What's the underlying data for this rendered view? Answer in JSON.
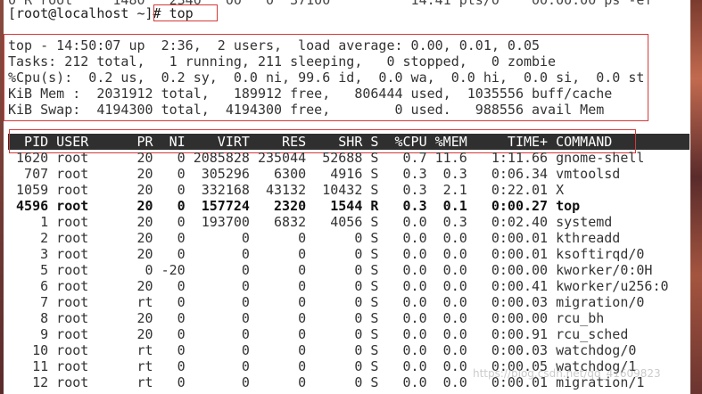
{
  "top_cutoff_line": "0 R root     1480   2340   00   0  37100          14:41 pts/0    00:00:00 ps -ef",
  "prompt": "[root@localhost ~]# top",
  "summary": [
    "top - 14:50:07 up  2:36,  2 users,  load average: 0.00, 0.01, 0.05",
    "Tasks: 212 total,   1 running, 211 sleeping,   0 stopped,   0 zombie",
    "%Cpu(s):  0.2 us,  0.2 sy,  0.0 ni, 99.6 id,  0.0 wa,  0.0 hi,  0.0 si,  0.0 st",
    "KiB Mem :  2031912 total,   189912 free,   806444 used,  1035556 buff/cache",
    "KiB Swap:  4194300 total,  4194300 free,        0 used.   988556 avail Mem"
  ],
  "table_header": "  PID USER      PR  NI    VIRT    RES    SHR S  %CPU %MEM     TIME+ COMMAND",
  "processes": [
    {
      "line": " 1620 root      20   0 2085828 235044  52688 S   0.7 11.6   1:11.66 gnome-shell",
      "bold": false
    },
    {
      "line": "  707 root      20   0  305296   6300   4916 S   0.3  0.3   0:06.34 vmtoolsd",
      "bold": false
    },
    {
      "line": " 1059 root      20   0  332168  43132  10432 S   0.3  2.1   0:22.01 X",
      "bold": false
    },
    {
      "line": " 4596 root      20   0  157724   2320   1544 R   0.3  0.1   0:00.27 top",
      "bold": true
    },
    {
      "line": "    1 root      20   0  193700   6832   4056 S   0.0  0.3   0:02.40 systemd",
      "bold": false
    },
    {
      "line": "    2 root      20   0       0      0      0 S   0.0  0.0   0:00.01 kthreadd",
      "bold": false
    },
    {
      "line": "    3 root      20   0       0      0      0 S   0.0  0.0   0:00.01 ksoftirqd/0",
      "bold": false
    },
    {
      "line": "    5 root       0 -20       0      0      0 S   0.0  0.0   0:00.00 kworker/0:0H",
      "bold": false
    },
    {
      "line": "    6 root      20   0       0      0      0 S   0.0  0.0   0:00.41 kworker/u256:0",
      "bold": false
    },
    {
      "line": "    7 root      rt   0       0      0      0 S   0.0  0.0   0:00.03 migration/0",
      "bold": false
    },
    {
      "line": "    8 root      20   0       0      0      0 S   0.0  0.0   0:00.00 rcu_bh",
      "bold": false
    },
    {
      "line": "    9 root      20   0       0      0      0 S   0.0  0.0   0:00.91 rcu_sched",
      "bold": false
    },
    {
      "line": "   10 root      rt   0       0      0      0 S   0.0  0.0   0:00.03 watchdog/0",
      "bold": false
    },
    {
      "line": "   11 root      rt   0       0      0      0 S   0.0  0.0   0:00.05 watchdog/1",
      "bold": false
    },
    {
      "line": "   12 root      rt   0       0      0      0 S   0.0  0.0   0:00.01 migration/1",
      "bold": false
    }
  ],
  "watermark": "https://blog.csdn.net/qq_41609823",
  "colors": {
    "header_bg": "#2f2f2f",
    "annotation_box": "#d43a3a"
  }
}
